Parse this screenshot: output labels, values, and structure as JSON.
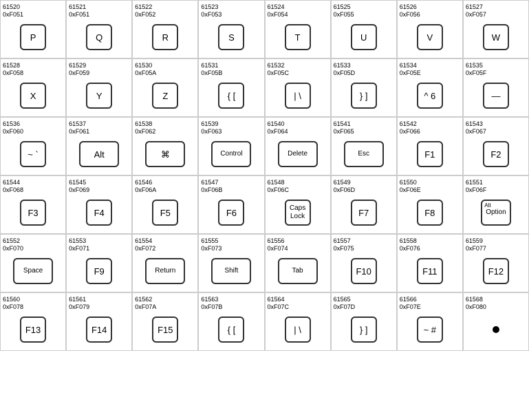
{
  "rows": [
    {
      "cells": [
        {
          "id": "61520",
          "hex": "0xF051",
          "label": "P"
        },
        {
          "id": "61521",
          "hex": "0xF051",
          "label": "Q"
        },
        {
          "id": "61522",
          "hex": "0xF052",
          "label": "R"
        },
        {
          "id": "61523",
          "hex": "0xF053",
          "label": "S"
        },
        {
          "id": "61524",
          "hex": "0xF054",
          "label": "T"
        },
        {
          "id": "61525",
          "hex": "0xF055",
          "label": "U"
        },
        {
          "id": "61526",
          "hex": "0xF056",
          "label": "V"
        },
        {
          "id": "61527",
          "hex": "0xF057",
          "label": "W"
        }
      ]
    },
    {
      "cells": [
        {
          "id": "61528",
          "hex": "0xF058",
          "label": "X"
        },
        {
          "id": "61529",
          "hex": "0xF059",
          "label": "Y"
        },
        {
          "id": "61530",
          "hex": "0xF05A",
          "label": "Z"
        },
        {
          "id": "61531",
          "hex": "0xF05B",
          "label": "{ ["
        },
        {
          "id": "61532",
          "hex": "0xF05C",
          "label": "| \\"
        },
        {
          "id": "61533",
          "hex": "0xF05D",
          "label": "} ]"
        },
        {
          "id": "61534",
          "hex": "0xF05E",
          "label": "^ 6",
          "sup": "^"
        },
        {
          "id": "61535",
          "hex": "0xF05F",
          "label": "—"
        }
      ]
    },
    {
      "cells": [
        {
          "id": "61536",
          "hex": "0xF060",
          "label": "~ `"
        },
        {
          "id": "61537",
          "hex": "0xF061",
          "label": "Alt",
          "wide": true
        },
        {
          "id": "61538",
          "hex": "0xF062",
          "label": "⌘",
          "wide": true
        },
        {
          "id": "61539",
          "hex": "0xF063",
          "label": "Control",
          "wide": true,
          "small": true
        },
        {
          "id": "61540",
          "hex": "0xF064",
          "label": "Delete",
          "wide": true,
          "small": true
        },
        {
          "id": "61541",
          "hex": "0xF065",
          "label": "Esc",
          "wide": true,
          "small": true
        },
        {
          "id": "61542",
          "hex": "0xF066",
          "label": "F1"
        },
        {
          "id": "61543",
          "hex": "0xF067",
          "label": "F2"
        }
      ]
    },
    {
      "cells": [
        {
          "id": "61544",
          "hex": "0xF068",
          "label": "F3"
        },
        {
          "id": "61545",
          "hex": "0xF069",
          "label": "F4"
        },
        {
          "id": "61546",
          "hex": "0xF06A",
          "label": "F5"
        },
        {
          "id": "61547",
          "hex": "0xF06B",
          "label": "F6"
        },
        {
          "id": "61548",
          "hex": "0xF06C",
          "label": "Caps\nLock",
          "small": true
        },
        {
          "id": "61549",
          "hex": "0xF06D",
          "label": "F7"
        },
        {
          "id": "61550",
          "hex": "0xF06E",
          "label": "F8"
        },
        {
          "id": "61551",
          "hex": "0xF06F",
          "label": "Option",
          "small": true,
          "toplabel": "Alt"
        }
      ]
    },
    {
      "cells": [
        {
          "id": "61552",
          "hex": "0xF070",
          "label": "Space",
          "wide": true,
          "small": true
        },
        {
          "id": "61553",
          "hex": "0xF071",
          "label": "F9"
        },
        {
          "id": "61554",
          "hex": "0xF072",
          "label": "Return",
          "wide": true,
          "small": true
        },
        {
          "id": "61555",
          "hex": "0xF073",
          "label": "Shift",
          "wide": true,
          "small": true
        },
        {
          "id": "61556",
          "hex": "0xF074",
          "label": "Tab",
          "wide": true,
          "small": true
        },
        {
          "id": "61557",
          "hex": "0xF075",
          "label": "F10"
        },
        {
          "id": "61558",
          "hex": "0xF076",
          "label": "F11"
        },
        {
          "id": "61559",
          "hex": "0xF077",
          "label": "F12"
        }
      ]
    },
    {
      "cells": [
        {
          "id": "61560",
          "hex": "0xF078",
          "label": "F13"
        },
        {
          "id": "61561",
          "hex": "0xF079",
          "label": "F14"
        },
        {
          "id": "61562",
          "hex": "0xF07A",
          "label": "F15"
        },
        {
          "id": "61563",
          "hex": "0xF07B",
          "label": "{ ["
        },
        {
          "id": "61564",
          "hex": "0xF07C",
          "label": "| \\"
        },
        {
          "id": "61565",
          "hex": "0xF07D",
          "label": "} ]"
        },
        {
          "id": "61566",
          "hex": "0xF07E",
          "label": "~ #"
        },
        {
          "id": "61568",
          "hex": "0xF080",
          "label": "•",
          "dot": true
        }
      ]
    }
  ]
}
